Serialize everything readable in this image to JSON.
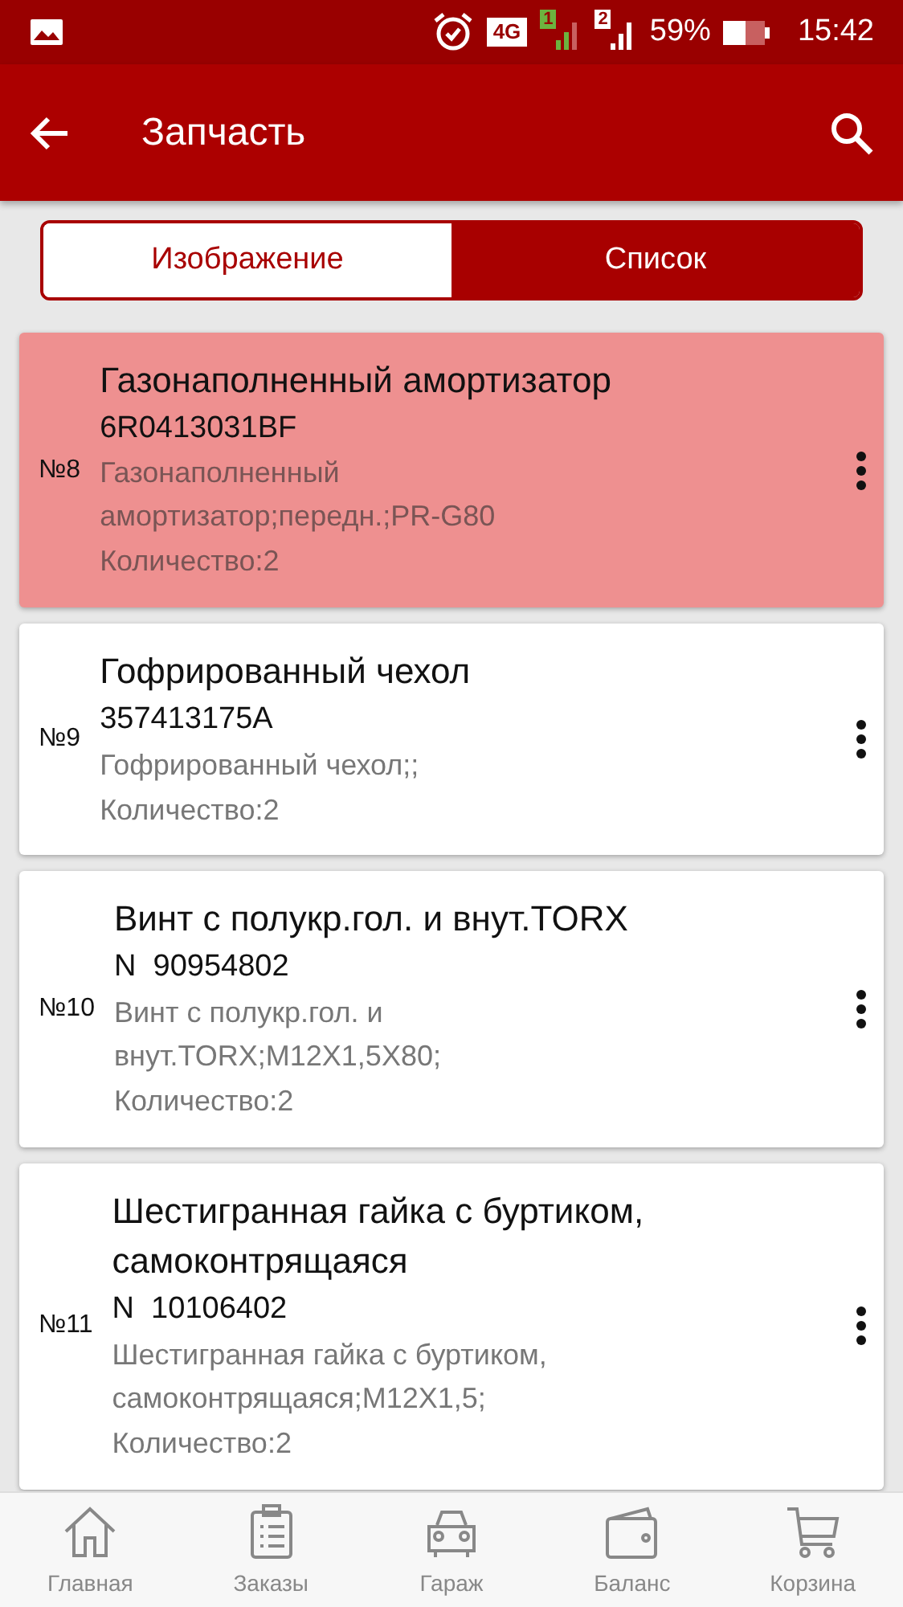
{
  "status_bar": {
    "network": "4G",
    "sim_1": "1",
    "sim_2": "2",
    "battery": "59%",
    "time": "15:42"
  },
  "app_bar": {
    "title": "Запчасть"
  },
  "view_switch": [
    {
      "label": "Изображение",
      "selected": false
    },
    {
      "label": "Список",
      "selected": true
    }
  ],
  "parts": [
    {
      "number": "№8",
      "name": "Газонаполненный амортизатор",
      "code": "6R0413031BF",
      "description": "Газонаполненный амортизатор;передн.;PR-G80",
      "quantity": "Количество:2",
      "selected": true
    },
    {
      "number": "№9",
      "name": "Гофрированный чехол",
      "code": "357413175A",
      "description": "Гофрированный чехол;;",
      "quantity": "Количество:2",
      "selected": false
    },
    {
      "number": "№10",
      "name": "Винт с полукр.гол. и внут.TORX",
      "code": "N  90954802",
      "description": "Винт с полукр.гол. и внут.TORX;M12X1,5X80;",
      "quantity": "Количество:2",
      "selected": false
    },
    {
      "number": "№11",
      "name": "Шестигранная гайка с буртиком, самоконтрящаяся",
      "code": "N  10106402",
      "description": "Шестигранная гайка с буртиком, самоконтрящаяся;M12X1,5;",
      "quantity": "Количество:2",
      "selected": false
    }
  ],
  "bottom_nav": [
    {
      "label": "Главная",
      "kind": "home"
    },
    {
      "label": "Заказы",
      "kind": "orders"
    },
    {
      "label": "Гараж",
      "kind": "garage"
    },
    {
      "label": "Баланс",
      "kind": "balance"
    },
    {
      "label": "Корзина",
      "kind": "cart"
    }
  ]
}
